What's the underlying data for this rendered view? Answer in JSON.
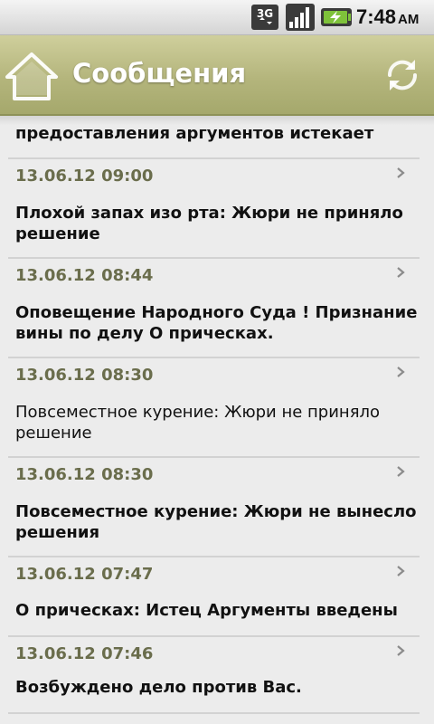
{
  "status_bar": {
    "network": "3G",
    "time": "7:48",
    "ampm": "AM"
  },
  "header": {
    "title": "Сообщения",
    "home_icon": "home-icon",
    "refresh_icon": "refresh-icon",
    "accent_color": "#b4b57c"
  },
  "partial_item": {
    "text": "предоставления аргументов истекает"
  },
  "messages": [
    {
      "date": "13.06.12 09:00",
      "text": "Плохой запах изо рта: Жюри не приняло решение",
      "unread": true
    },
    {
      "date": "13.06.12 08:44",
      "text": "Оповещение Народного Суда ! Признание вины по делу О прическах.",
      "unread": true
    },
    {
      "date": "13.06.12 08:30",
      "text": "Повсеместное курение: Жюри не приняло решение",
      "unread": false
    },
    {
      "date": "13.06.12 08:30",
      "text": "Повсеместное курение: Жюри не вынесло решения",
      "unread": true
    },
    {
      "date": "13.06.12 07:47",
      "text": "О прическах: Истец Аргументы введены",
      "unread": true
    },
    {
      "date": "13.06.12 07:46",
      "text": "Возбуждено дело против Вас.",
      "unread": true
    }
  ]
}
